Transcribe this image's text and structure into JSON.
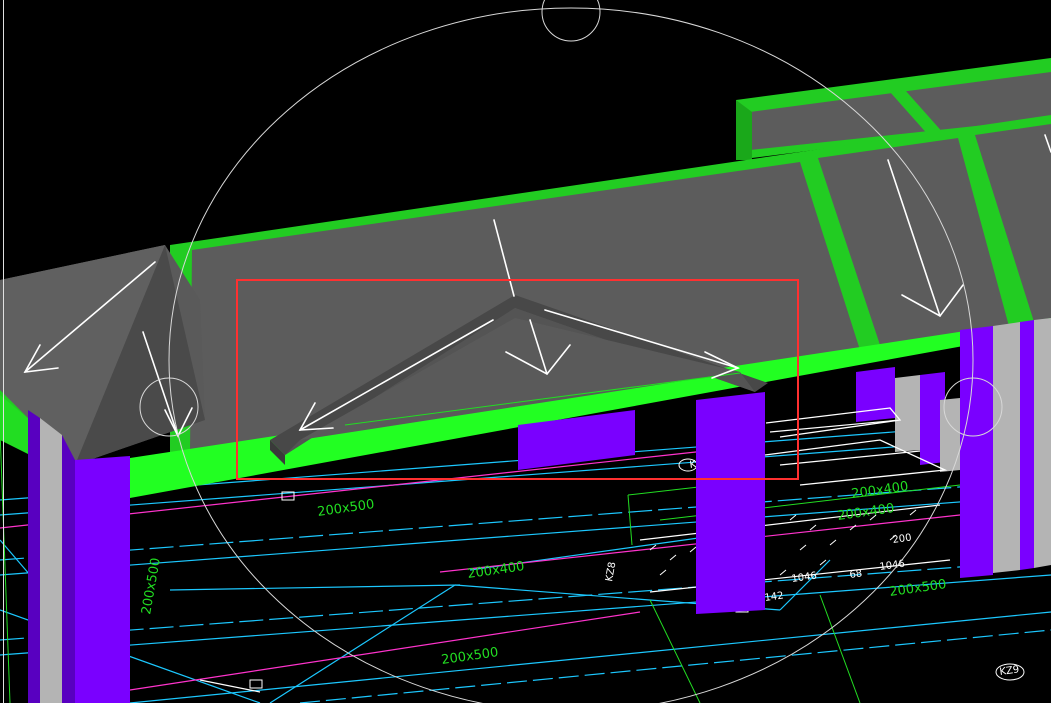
{
  "colors": {
    "background": "#000000",
    "roof_gray": "#5c5c5c",
    "roof_dark": "#474747",
    "beam_green": "#22cc22",
    "beam_green_bright": "#22ff22",
    "column_purple": "#7a00ff",
    "column_purple_dark": "#5800c0",
    "wall_gray": "#b4b4b4",
    "cad_cyan": "#1cc8ff",
    "cad_magenta": "#ff33cc",
    "cad_green": "#22dd22",
    "arrow_white": "#ffffff",
    "selection_red": "#ff3030"
  },
  "icons": {
    "orbit": "orbit-circle-icon",
    "slope_arrow": "slope-arrow-icon"
  },
  "dimensions": {
    "d1": "200x500",
    "d2": "200x400",
    "d3": "200x500",
    "d4": "200x400",
    "d5": "200x400",
    "d6": "200x500",
    "d7": "200x500",
    "d8": "1046",
    "d9": "1046",
    "d10": "200",
    "d11": "142",
    "d12": "68"
  },
  "labels": {
    "tag1": "KZL1",
    "tag2": "KZ8",
    "tag3": "KZ9"
  }
}
